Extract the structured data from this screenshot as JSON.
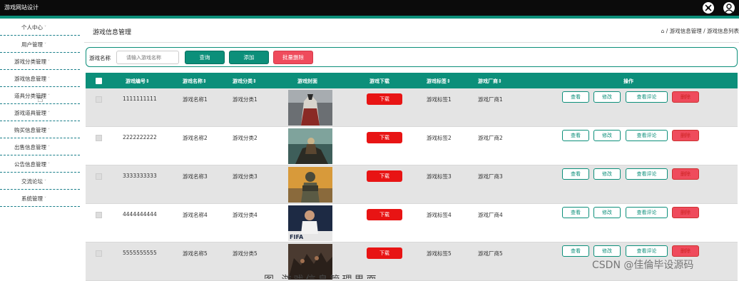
{
  "app": {
    "title": "游戏网站设计",
    "colors": {
      "accent": "#0c8f7a",
      "topbar": "#0b0b0b",
      "danger": "#ef4b5c",
      "download": "#e81414"
    }
  },
  "sidebar": {
    "items": [
      {
        "label": "个人中心"
      },
      {
        "label": "用户管理"
      },
      {
        "label": "游戏分类管理"
      },
      {
        "label": "游戏信息管理"
      },
      {
        "label": "道具分类管理"
      },
      {
        "label": "游戏道具管理"
      },
      {
        "label": "购买信息管理"
      },
      {
        "label": "出售信息管理"
      },
      {
        "label": "公告信息管理"
      },
      {
        "label": "交流论坛"
      },
      {
        "label": "系统管理"
      }
    ],
    "caret": "ˇ"
  },
  "header": {
    "title": "游戏信息管理",
    "breadcrumb": "⌂ / 游戏信息管理 / 游戏信息列表"
  },
  "search": {
    "label": "游戏名称",
    "placeholder": "请输入游戏名称",
    "query_label": "查询",
    "add_label": "添加",
    "batch_delete_label": "批量删除"
  },
  "table": {
    "columns": [
      "游戏编号⇕",
      "游戏名称⇕",
      "游戏分类⇕",
      "游戏封面",
      "游戏下载",
      "游戏标签⇕",
      "游戏厂商⇕",
      "操作"
    ],
    "download_label": "下载",
    "actions": {
      "view": "查看",
      "edit": "修改",
      "review": "查看评论",
      "delete": "删除"
    },
    "rows": [
      {
        "id": "1111111111",
        "name": "游戏名称1",
        "category": "游戏分类1",
        "tag": "游戏标签1",
        "vendor": "游戏厂商1",
        "cover": "hooded-warrior"
      },
      {
        "id": "2222222222",
        "name": "游戏名称2",
        "category": "游戏分类2",
        "tag": "游戏标签2",
        "vendor": "游戏厂商2",
        "cover": "fantasy-rider"
      },
      {
        "id": "3333333333",
        "name": "游戏名称3",
        "category": "游戏分类3",
        "tag": "游戏标签3",
        "vendor": "游戏厂商3",
        "cover": "helmet-soldier"
      },
      {
        "id": "4444444444",
        "name": "游戏名称4",
        "category": "游戏分类4",
        "tag": "游戏标签4",
        "vendor": "游戏厂商4",
        "cover": "football-player"
      },
      {
        "id": "5555555555",
        "name": "游戏名称5",
        "category": "游戏分类5",
        "tag": "游戏标签5",
        "vendor": "游戏厂商5",
        "cover": "army-crowd"
      }
    ]
  },
  "watermark": "CSDN @佳倫毕设源码",
  "caption": "图 游戏信息管理界面"
}
